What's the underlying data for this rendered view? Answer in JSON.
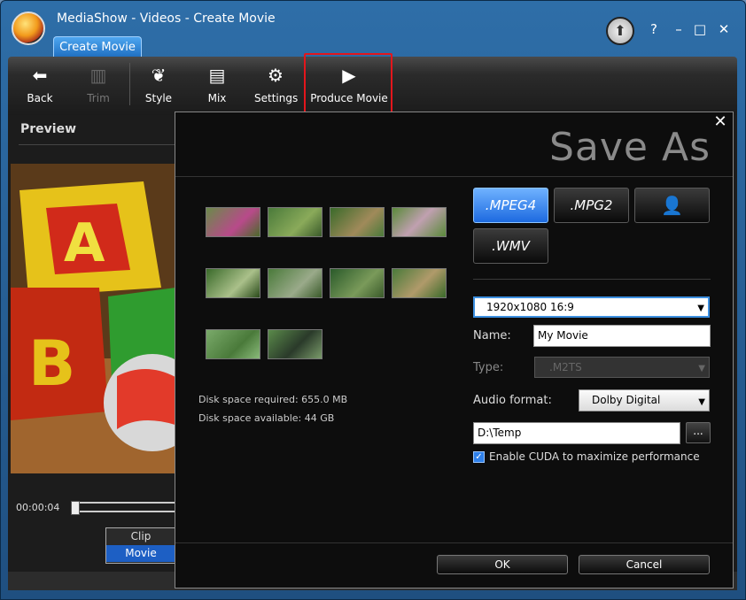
{
  "app": {
    "title": "MediaShow - Videos - Create Movie",
    "help": "?",
    "minimize": "–",
    "maximize": "□",
    "close": "✕"
  },
  "tab": {
    "label": "Create Movie"
  },
  "toolbar": {
    "back": "Back",
    "trim": "Trim",
    "style": "Style",
    "mix": "Mix",
    "settings": "Settings",
    "produce": "Produce Movie"
  },
  "preview": {
    "heading": "Preview",
    "timecode": "00:00:04",
    "clip": "Clip",
    "movie": "Movie"
  },
  "dialog": {
    "title": "Save As",
    "close": "✕",
    "disk_required": "Disk space required: 655.0 MB",
    "disk_available": "Disk space available: 44 GB",
    "formats": {
      "mpeg4": ".MPEG4",
      "mpg2": ".MPG2",
      "wmv": ".WMV"
    },
    "resolution": "1920x1080 16:9",
    "name_label": "Name:",
    "name_value": "My Movie",
    "type_label": "Type:",
    "type_value": ".M2TS",
    "audio_label": "Audio format:",
    "audio_value": "Dolby Digital",
    "path_value": "D:\\Temp",
    "browse": "...",
    "cuda_label": "Enable CUDA to maximize performance",
    "ok": "OK",
    "cancel": "Cancel"
  },
  "colors": {
    "accent": "#1d6ae0",
    "highlight_box": "#e3161c",
    "window_frame": "#2e6ea8"
  }
}
